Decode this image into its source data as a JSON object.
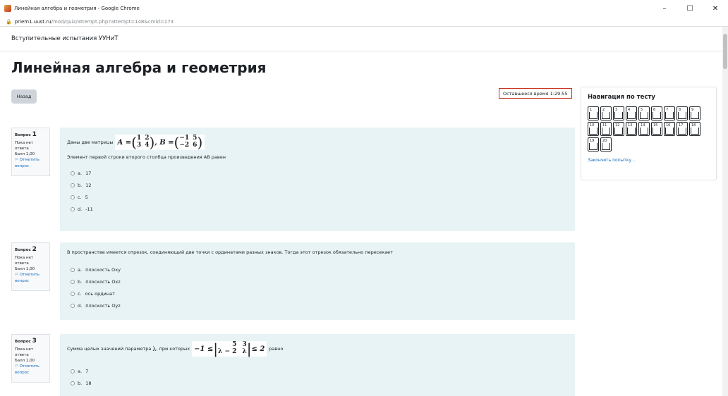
{
  "browser": {
    "window_title": "Линейная алгебра и геометрия - Google Chrome",
    "url_host": "priem1.uust.ru",
    "url_path": "/mod/quiz/attempt.php?attempt=148&cmid=173",
    "controls": {
      "minimize": "–",
      "maximize": "☐",
      "close": "✕"
    }
  },
  "site": {
    "name": "Вступительные испытания УУНиТ"
  },
  "page": {
    "title": "Линейная алгебра и геометрия",
    "back_button": "Назад",
    "timer": "Оставшееся время 1:29:55"
  },
  "questions": [
    {
      "label": "Вопрос",
      "number": "1",
      "status": "Пока нет ответа",
      "grade": "Балл 1,00",
      "flag": "Отметить вопрос",
      "text_before": "Даны две матрицы",
      "math": {
        "A_name": "A =",
        "A_cells": [
          "1",
          "2",
          "3",
          "4"
        ],
        "B_name": "B =",
        "B_cells": [
          "−1",
          "5",
          "−2",
          "6"
        ],
        "sep": ","
      },
      "text_second": "Элемент первой строки второго столбца произведения AB равен",
      "answers": [
        {
          "letter": "a.",
          "text": "17"
        },
        {
          "letter": "b.",
          "text": "12"
        },
        {
          "letter": "c.",
          "text": "5"
        },
        {
          "letter": "d.",
          "text": "-11"
        }
      ]
    },
    {
      "label": "Вопрос",
      "number": "2",
      "status": "Пока нет ответа",
      "grade": "Балл 1,00",
      "flag": "Отметить вопрос",
      "text": "В пространстве имеется отрезок, соединяющий две точки с ординатами разных знаков. Тогда этот отрезок обязательно пересекает",
      "answers": [
        {
          "letter": "a.",
          "text": "плоскость Oxy"
        },
        {
          "letter": "b.",
          "text": "плоскость Oxz"
        },
        {
          "letter": "c.",
          "text": "ось ординат"
        },
        {
          "letter": "d.",
          "text": "плоскость Oyz"
        }
      ]
    },
    {
      "label": "Вопрос",
      "number": "3",
      "status": "Пока нет ответа",
      "grade": "Балл 1,00",
      "flag": "Отметить вопрос",
      "text_before": "Сумма целых значений параметра",
      "lambda": "λ",
      "text_mid": ", при которых",
      "math": {
        "left": "−1 ≤",
        "cells": [
          "5",
          "3",
          "λ − 2",
          "λ"
        ],
        "right": "≤ 2"
      },
      "text_after": "равно",
      "answers": [
        {
          "letter": "a.",
          "text": "7"
        },
        {
          "letter": "b.",
          "text": "18"
        }
      ]
    }
  ],
  "navigation": {
    "title": "Навигация по тесту",
    "buttons": [
      "1",
      "2",
      "3",
      "4",
      "5",
      "6",
      "7",
      "8",
      "9",
      "10",
      "11",
      "12",
      "13",
      "14",
      "15",
      "16",
      "17",
      "18",
      "19",
      "20"
    ],
    "finish_link": "Закончить попытку..."
  },
  "colors": {
    "question_bg": "#e7f3f5",
    "timer_border": "#ca3120",
    "link": "#0f6cbf"
  }
}
